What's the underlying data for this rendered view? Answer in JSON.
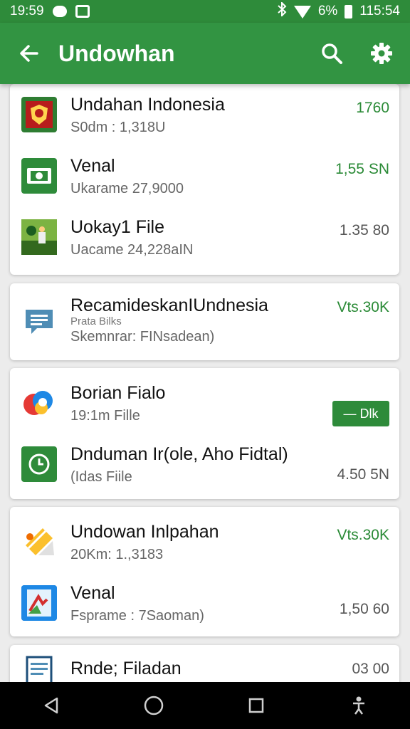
{
  "status_bar": {
    "time_left": "19:59",
    "battery": "6%",
    "time_right": "115:54"
  },
  "app_bar": {
    "title": "Undowhan",
    "icons": [
      "arrow-back-icon",
      "search-icon",
      "gear-icon"
    ]
  },
  "cards": [
    {
      "items": [
        {
          "name": "Undahan Indonesia",
          "sub": "S0dm : 1,318U",
          "value": "1760",
          "value_color": "green",
          "icon": "shield-app-icon"
        },
        {
          "name": "Venal",
          "sub": "Ukarame 27,9000",
          "value": "1,55 SN",
          "value_color": "green",
          "icon": "green-box-app-icon"
        },
        {
          "name": "Uokay1 File",
          "sub": "Uacame 24,228aIN",
          "value": "1.35 80",
          "value_color": "gray",
          "icon": "landscape-app-icon"
        }
      ]
    },
    {
      "items": [
        {
          "name": "RecamideskanIUndnesia",
          "sub_small": "Prata Bilks",
          "sub": "Skemnrar: FINsadean)",
          "value": "Vts.30K",
          "value_color": "green",
          "icon": "chat-bubble-icon"
        }
      ]
    },
    {
      "items": [
        {
          "name": "Borian Fialo",
          "sub": "19:1m Fille",
          "button_label": "— Dlk",
          "icon": "colorful-blob-app-icon"
        },
        {
          "name": "Dnduman Ir(ole, Aho Fidtal)",
          "sub": "(Idas Fiile",
          "value": "4.50 5N",
          "value_color": "gray",
          "icon": "clock-app-icon"
        }
      ]
    },
    {
      "items": [
        {
          "name": "Undowan Inlpahan",
          "sub": "20Km: 1.,3183",
          "value": "Vts.30K",
          "value_color": "green",
          "icon": "yellow-pencil-app-icon"
        },
        {
          "name": "Venal",
          "sub": "Fsprame : 7Saoman)",
          "value": "1,50 60",
          "value_color": "gray",
          "icon": "blue-clipboard-app-icon"
        }
      ]
    },
    {
      "items": [
        {
          "name": "Rnde; Filadan",
          "value": "03 00",
          "value_color": "gray",
          "icon": "document-icon"
        }
      ]
    }
  ],
  "nav_bar": {
    "icons": [
      "back-triangle-icon",
      "home-circle-icon",
      "recents-square-icon",
      "accessibility-icon"
    ]
  },
  "colors": {
    "primary": "#329442",
    "status": "#2e8b3a",
    "value_green": "#2a8a36"
  }
}
